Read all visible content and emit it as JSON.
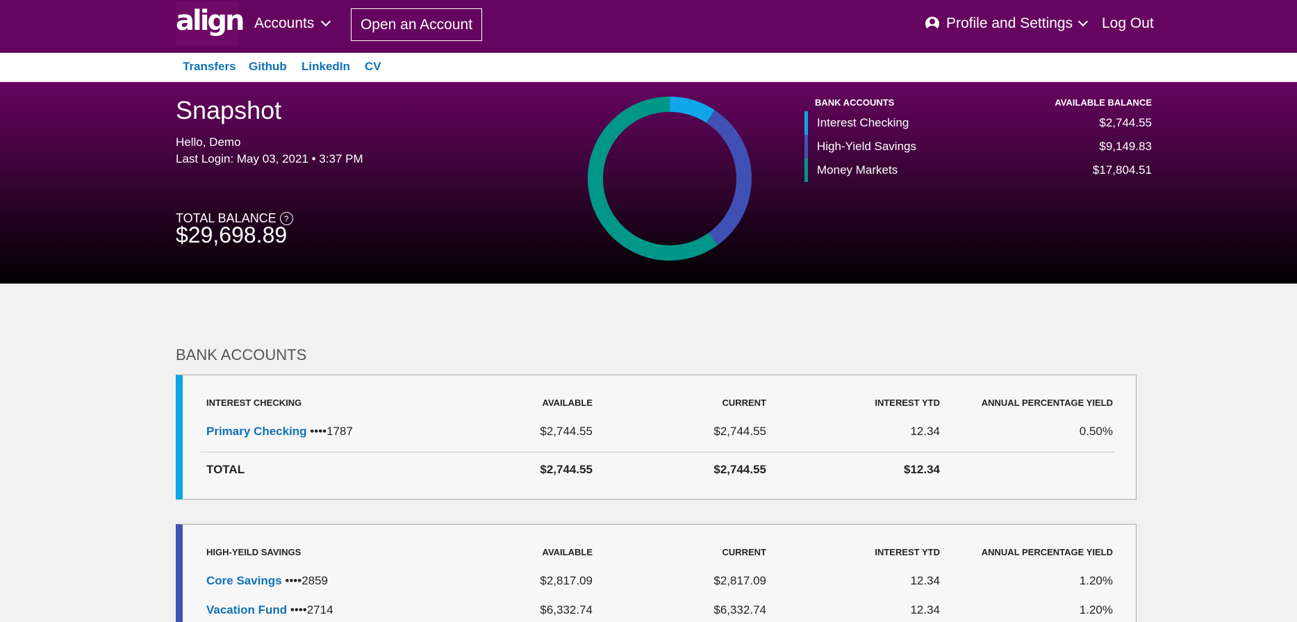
{
  "nav": {
    "logo": "align",
    "accounts": "Accounts",
    "open_account": "Open an Account",
    "profile": "Profile and Settings",
    "logout": "Log Out"
  },
  "subnav": [
    "Transfers",
    "Github",
    "LinkedIn",
    "CV"
  ],
  "hero": {
    "title": "Snapshot",
    "greeting": "Hello, Demo",
    "last_login": "Last Login: May 03, 2021 • 3:37 PM",
    "total_balance_label": "TOTAL BALANCE",
    "total_balance_value": "$29,698.89"
  },
  "legend": {
    "col1": "BANK ACCOUNTS",
    "col2": "AVAILABLE BALANCE",
    "rows": [
      {
        "name": "Interest Checking",
        "value": "$2,744.55",
        "color": "#0ea5e9"
      },
      {
        "name": "High-Yield Savings",
        "value": "$9,149.83",
        "color": "#3f51b5"
      },
      {
        "name": "Money Markets",
        "value": "$17,804.51",
        "color": "#009688"
      }
    ]
  },
  "chart_data": {
    "type": "pie",
    "categories": [
      "Interest Checking",
      "High-Yield Savings",
      "Money Markets"
    ],
    "values": [
      2744.55,
      9149.83,
      17804.51
    ],
    "colors": [
      "#0ea5e9",
      "#3f51b5",
      "#009688"
    ]
  },
  "main": {
    "section_title": "BANK ACCOUNTS",
    "checking": {
      "headers": [
        "INTEREST CHECKING",
        "AVAILABLE",
        "CURRENT",
        "INTEREST YTD",
        "ANNUAL PERCENTAGE YIELD"
      ],
      "rows": [
        {
          "name": "Primary Checking",
          "mask": "••••1787",
          "available": "$2,744.55",
          "current": "$2,744.55",
          "interest": "12.34",
          "apy": "0.50%"
        }
      ],
      "total": {
        "label": "TOTAL",
        "available": "$2,744.55",
        "current": "$2,744.55",
        "interest": "$12.34"
      }
    },
    "savings": {
      "headers": [
        "HIGH-YEILD SAVINGS",
        "AVAILABLE",
        "CURRENT",
        "INTEREST YTD",
        "ANNUAL PERCENTAGE YIELD"
      ],
      "rows": [
        {
          "name": "Core Savings",
          "mask": "••••2859",
          "available": "$2,817.09",
          "current": "$2,817.09",
          "interest": "12.34",
          "apy": "1.20%"
        },
        {
          "name": "Vacation Fund",
          "mask": "••••2714",
          "available": "$6,332.74",
          "current": "$6,332.74",
          "interest": "12.34",
          "apy": "1.20%"
        }
      ]
    }
  }
}
